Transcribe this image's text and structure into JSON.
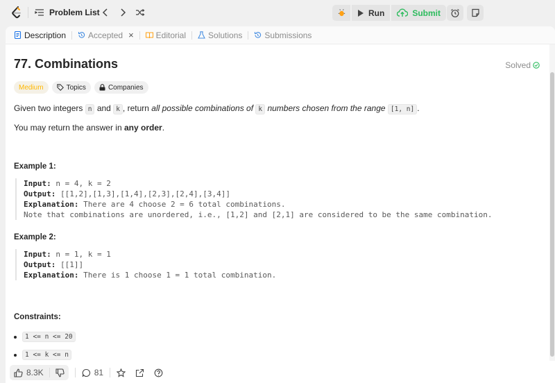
{
  "topbar": {
    "problem_list_label": "Problem List",
    "run_label": "Run",
    "submit_label": "Submit"
  },
  "tabs": [
    {
      "label": "Description"
    },
    {
      "label": "Accepted"
    },
    {
      "label": "Editorial"
    },
    {
      "label": "Solutions"
    },
    {
      "label": "Submissions"
    }
  ],
  "problem": {
    "title": "77. Combinations",
    "status": "Solved",
    "difficulty": "Medium",
    "topics_label": "Topics",
    "companies_label": "Companies",
    "desc_1": "Given two integers",
    "code_n": "n",
    "desc_and": "and",
    "code_k": "k",
    "desc_return": ", return",
    "desc_italic": "all possible combinations of",
    "desc_italic2": "numbers chosen from the range",
    "code_range": "[1, n]",
    "desc_period": ".",
    "order_1": "You may return the answer in",
    "order_bold": "any order",
    "order_period": "."
  },
  "examples": [
    {
      "heading": "Example 1:",
      "input_label": "Input:",
      "input": "n = 4, k = 2",
      "output_label": "Output:",
      "output": "[[1,2],[1,3],[1,4],[2,3],[2,4],[3,4]]",
      "expl_label": "Explanation:",
      "explanation": "There are 4 choose 2 = 6 total combinations.",
      "note": "Note that combinations are unordered, i.e., [1,2] and [2,1] are considered to be the same combination."
    },
    {
      "heading": "Example 2:",
      "input_label": "Input:",
      "input": "n = 1, k = 1",
      "output_label": "Output:",
      "output": "[[1]]",
      "expl_label": "Explanation:",
      "explanation": "There is 1 choose 1 = 1 total combination."
    }
  ],
  "constraints": {
    "heading": "Constraints:",
    "items": [
      "1 <= n <= 20",
      "1 <= k <= n"
    ]
  },
  "bottom": {
    "likes": "8.3K",
    "comments": "81"
  },
  "colors": {
    "accent_submit": "#2cbb5d",
    "medium": "#ffb800",
    "logo": "#ffa116"
  }
}
